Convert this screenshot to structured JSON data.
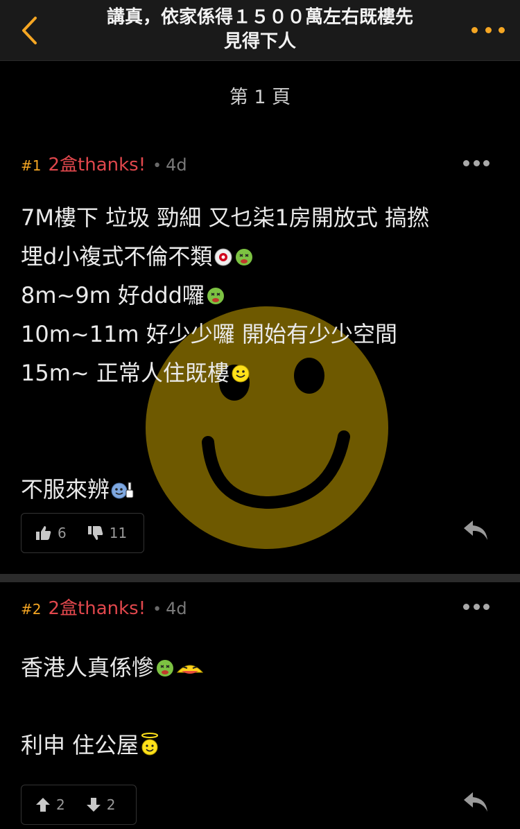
{
  "header": {
    "title_line1": "講真，依家係得１５００萬左右既樓先",
    "title_line2": "見得下人",
    "accent_color": "#f5a623"
  },
  "page_label": "第 1 頁",
  "posts": [
    {
      "num": "#1",
      "author": "2盒thanks!",
      "separator": "•",
      "age": "4d",
      "lines": [
        "7M樓下 垃圾 勁細 又乜柒1房開放式 搞撚",
        "埋d小複式不倫不類",
        "8m~9m 好ddd囉",
        "10m~11m 好少少囉 開始有少少空間",
        "15m~ 正常人住既樓",
        "",
        "",
        "不服來辨"
      ],
      "likes": "6",
      "dislikes": "11"
    },
    {
      "num": "#2",
      "author": "2盒thanks!",
      "separator": "•",
      "age": "4d",
      "lines": [
        "香港人真係慘",
        "",
        "利申 住公屋"
      ],
      "upvotes": "2",
      "downvotes": "2"
    }
  ],
  "colors": {
    "author": "#e0474c",
    "post_num": "#f5a623",
    "meta_gray": "#7a7a7a"
  }
}
